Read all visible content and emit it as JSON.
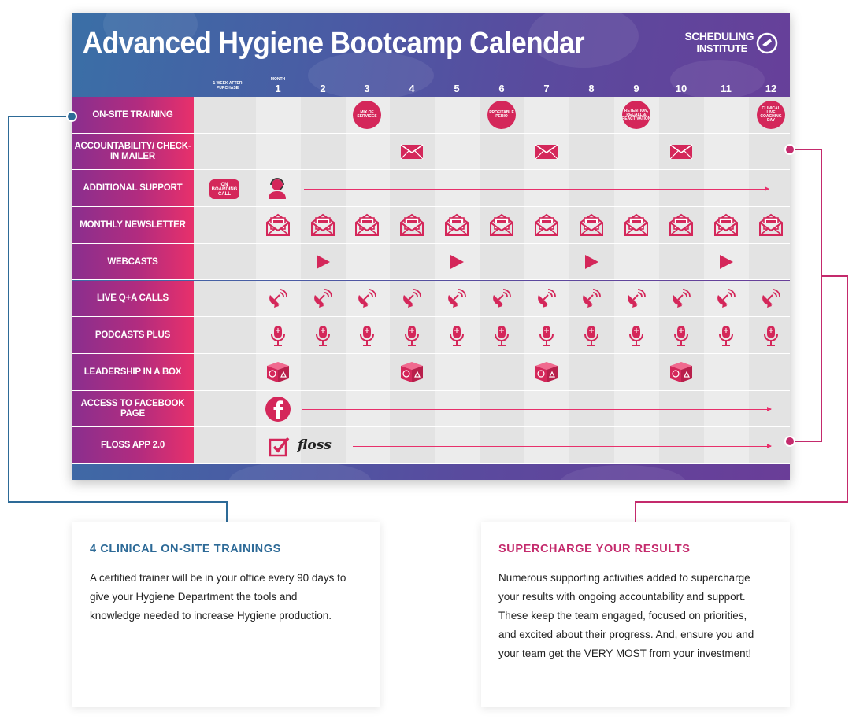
{
  "calendar": {
    "title": "Advanced Hygiene Bootcamp Calendar",
    "brand_line1": "SCHEDULING",
    "brand_line2": "INSTITUTE",
    "header": {
      "week_label": "1 WEEK AFTER PURCHASE",
      "month_label": "MONTH",
      "months": [
        "1",
        "2",
        "3",
        "4",
        "5",
        "6",
        "7",
        "8",
        "9",
        "10",
        "11",
        "12"
      ]
    },
    "rows": [
      {
        "label": "ON-SITE TRAINING"
      },
      {
        "label": "ACCOUNTABILITY/ CHECK-IN MAILER"
      },
      {
        "label": "ADDITIONAL SUPPORT"
      },
      {
        "label": "MONTHLY NEWSLETTER"
      },
      {
        "label": "WEBCASTS"
      },
      {
        "label": "LIVE Q+A CALLS"
      },
      {
        "label": "PODCASTS PLUS"
      },
      {
        "label": "LEADERSHIP IN A BOX"
      },
      {
        "label": "ACCESS TO FACEBOOK PAGE"
      },
      {
        "label": "FLOSS APP 2.0"
      }
    ],
    "onsite_trainings": [
      {
        "month": 3,
        "text": "MIX OF SERVICES"
      },
      {
        "month": 6,
        "text": "PROFITABLE PERIO"
      },
      {
        "month": 9,
        "text": "RETENTION, RECALL & REACTIVATION"
      },
      {
        "month": 12,
        "text": "CLINICAL LIVE COACHING DAY"
      }
    ],
    "mailer_months": [
      4,
      7,
      10
    ],
    "onboarding_label": "ON BOARDING CALL",
    "webcast_months": [
      2,
      5,
      8,
      11
    ],
    "leadership_months": [
      1,
      4,
      7,
      10
    ],
    "floss_logo": "floss",
    "colors": {
      "accent": "#d4275a",
      "blue": "#2d6a97",
      "pink": "#c42a6c"
    }
  },
  "cards": [
    {
      "title": "4 CLINICAL ON-SITE TRAININGS",
      "body": "A certified trainer will be in your office every 90 days to give your Hygiene Department the tools and knowledge needed to increase Hygiene production."
    },
    {
      "title": "SUPERCHARGE YOUR RESULTS",
      "body": "Numerous supporting activities added to supercharge your results with ongoing accountability and support. These keep the team engaged, focused on priorities, and excited about their progress. And, ensure you and your team get the VERY MOST from your investment!"
    }
  ]
}
